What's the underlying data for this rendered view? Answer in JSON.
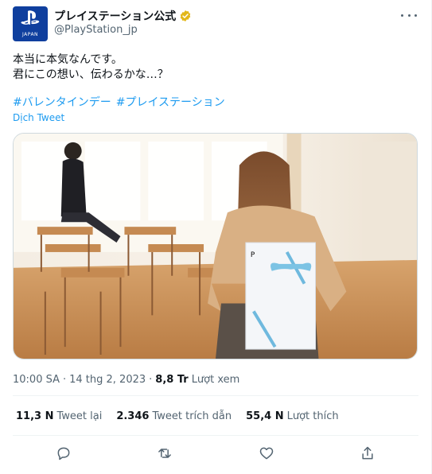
{
  "author": {
    "display_name": "プレイステーション公式",
    "handle": "@PlayStation_jp",
    "avatar_text": "JAPAN",
    "verified": true
  },
  "tweet": {
    "line1": "本当に本気なんです。",
    "line2": "君にこの想い、伝わるかな…？",
    "hashtags": [
      "#バレンタインデー",
      "#プレイステーション"
    ],
    "translate_label": "Dịch Tweet"
  },
  "meta": {
    "time": "10:00 SA",
    "date": "14 thg 2, 2023",
    "views_count": "8,8 Tr",
    "views_label": "Lượt xem"
  },
  "stats": {
    "retweets_count": "11,3 N",
    "retweets_label": "Tweet lại",
    "quotes_count": "2.346",
    "quotes_label": "Tweet trích dẫn",
    "likes_count": "55,4 N",
    "likes_label": "Lượt thích"
  },
  "colors": {
    "link": "#1d9bf0",
    "secondary_text": "#536471",
    "primary_text": "#0f1419",
    "avatar_bg": "#0f3f9e",
    "verified_badge": "#e2b719"
  },
  "icons": [
    "more-icon",
    "verified-icon",
    "reply-icon",
    "retweet-icon",
    "like-icon",
    "share-icon"
  ]
}
